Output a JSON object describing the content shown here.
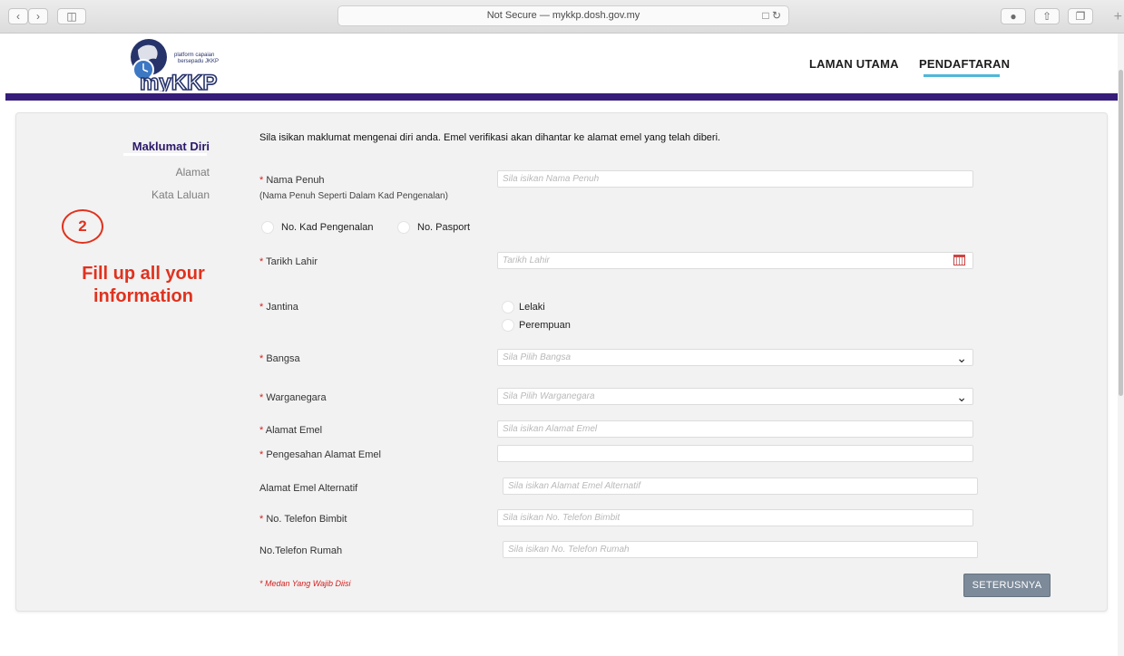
{
  "browser": {
    "url_text": "Not Secure — mykkp.dosh.gov.my"
  },
  "header": {
    "logo_text_line1": "platform capaian",
    "logo_text_line2": "bersepadu JKKP",
    "logo_brand": "myKKP",
    "nav": [
      {
        "label": "LAMAN UTAMA"
      },
      {
        "label": "PENDAFTARAN"
      }
    ]
  },
  "sidebar": {
    "steps": [
      {
        "label": "Maklumat Diri"
      },
      {
        "label": "Alamat"
      },
      {
        "label": "Kata Laluan"
      }
    ]
  },
  "annotation": {
    "step_number": "2",
    "text": "Fill up all your information"
  },
  "form": {
    "intro": "Sila isikan maklumat mengenai diri anda. Emel verifikasi akan dihantar ke alamat emel yang telah diberi.",
    "full_name": {
      "label": "Nama Penuh",
      "sub": "(Nama Penuh Seperti Dalam Kad Pengenalan)",
      "placeholder": "Sila isikan Nama Penuh"
    },
    "id_type": {
      "option1": "No. Kad Pengenalan",
      "option2": "No. Pasport"
    },
    "dob": {
      "label": "Tarikh Lahir",
      "placeholder": "Tarikh Lahir"
    },
    "gender": {
      "label": "Jantina",
      "option1": "Lelaki",
      "option2": "Perempuan"
    },
    "race": {
      "label": "Bangsa",
      "placeholder": "Sila Pilih Bangsa"
    },
    "citizenship": {
      "label": "Warganegara",
      "placeholder": "Sila Pilih Warganegara"
    },
    "email": {
      "label": "Alamat Emel",
      "placeholder": "Sila isikan Alamat Emel"
    },
    "email_confirm": {
      "label": "Pengesahan Alamat Emel",
      "placeholder": ""
    },
    "alt_email": {
      "label": "Alamat Emel Alternatif",
      "placeholder": "Sila isikan Alamat Emel Alternatif"
    },
    "mobile": {
      "label": "No. Telefon Bimbit",
      "placeholder": "Sila isikan No. Telefon Bimbit"
    },
    "home_phone": {
      "label": "No.Telefon Rumah",
      "placeholder": "Sila isikan No. Telefon Rumah"
    },
    "required_star": "*",
    "required_note": "* Medan Yang Wajib Diisi",
    "next_button": "SETERUSNYA"
  }
}
